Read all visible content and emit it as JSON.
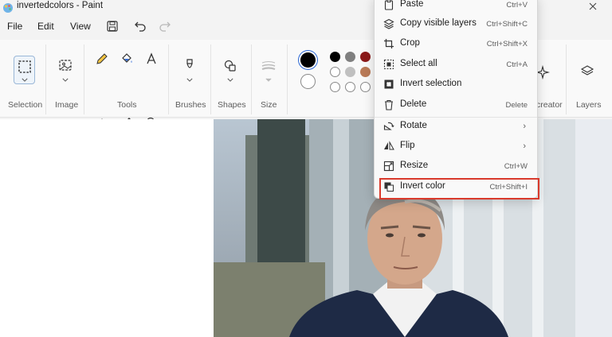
{
  "window": {
    "title": "invertedcolors - Paint"
  },
  "menubar": {
    "file": "File",
    "edit": "Edit",
    "view": "View"
  },
  "ribbon": {
    "groups": {
      "selection": "Selection",
      "image": "Image",
      "tools": "Tools",
      "brushes": "Brushes",
      "shapes": "Shapes",
      "size": "Size",
      "creator": "creator",
      "layers": "Layers"
    },
    "colors": {
      "primary": "#000000",
      "secondary": "#ffffff",
      "palette": [
        "#000000",
        "#808080",
        "#8b1a1a",
        "#ffffff",
        "#c0c0c0",
        "#b97a57",
        "#ffffff",
        "#ffffff",
        "#ffffff"
      ]
    }
  },
  "context_menu": {
    "items": [
      {
        "label": "Paste",
        "shortcut": "Ctrl+V",
        "icon": "paste-icon"
      },
      {
        "label": "Copy visible layers",
        "shortcut": "Ctrl+Shift+C",
        "icon": "copy-layers-icon"
      },
      {
        "label": "Crop",
        "shortcut": "Ctrl+Shift+X",
        "icon": "crop-icon"
      },
      {
        "label": "Select all",
        "shortcut": "Ctrl+A",
        "icon": "select-all-icon"
      },
      {
        "label": "Invert selection",
        "shortcut": "",
        "icon": "invert-selection-icon"
      },
      {
        "label": "Delete",
        "shortcut": "Delete",
        "icon": "trash-icon"
      },
      {
        "label": "Rotate",
        "shortcut": "",
        "icon": "rotate-icon"
      },
      {
        "label": "Flip",
        "shortcut": "",
        "icon": "flip-icon"
      },
      {
        "label": "Resize",
        "shortcut": "Ctrl+W",
        "icon": "resize-icon"
      },
      {
        "label": "Invert color",
        "shortcut": "Ctrl+Shift+I",
        "icon": "invert-color-icon"
      }
    ],
    "highlight_color": "#d9392b"
  }
}
